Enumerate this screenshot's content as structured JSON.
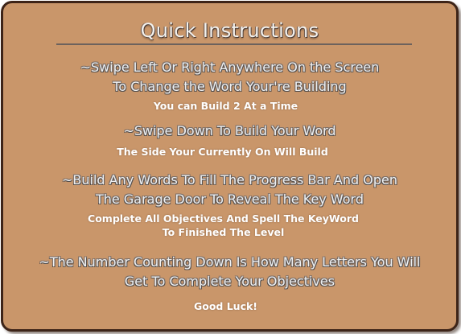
{
  "title": "Quick Instructions",
  "items": [
    {
      "lines": [
        "~Swipe Left Or Right Anywhere On the Screen",
        "To Change the Word Your're Building"
      ],
      "notes": [
        "You can Build 2 At a Time"
      ]
    },
    {
      "lines": [
        "~Swipe Down To Build Your Word"
      ],
      "notes": [
        "The Side Your Currently On Will Build"
      ]
    },
    {
      "lines": [
        "~Build Any Words To Fill The Progress Bar And Open",
        "The Garage Door To Reveal The Key Word"
      ],
      "notes": [
        "Complete All Objectives And Spell The KeyWord",
        "To Finished The Level"
      ]
    },
    {
      "lines": [
        "~The Number Counting Down Is How Many Letters You Will",
        "Get To Complete Your Objectives"
      ],
      "notes": []
    }
  ],
  "closing": "Good Luck!"
}
